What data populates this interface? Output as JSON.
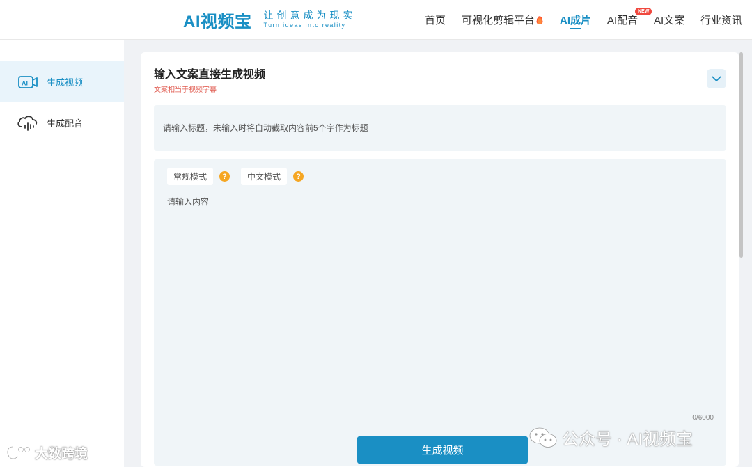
{
  "logo": {
    "main": "AI视频宝",
    "slogan_cn": "让创意成为现实",
    "slogan_en": "Turn ideas into reality"
  },
  "nav": {
    "items": [
      {
        "label": "首页"
      },
      {
        "label": "可视化剪辑平台"
      },
      {
        "label": "AI成片"
      },
      {
        "label": "AI配音"
      },
      {
        "label": "AI文案"
      },
      {
        "label": "行业资讯"
      }
    ],
    "new_badge": "NEW"
  },
  "sidebar": {
    "items": [
      {
        "label": "生成视频"
      },
      {
        "label": "生成配音"
      }
    ]
  },
  "card": {
    "title": "输入文案直接生成视频",
    "subtitle": "文案相当于视频字幕",
    "title_placeholder": "请输入标题，未输入时将自动截取内容前5个字作为标题",
    "mode_normal": "常规模式",
    "mode_chinese": "中文模式",
    "content_placeholder": "请输入内容",
    "counter": "0/6000"
  },
  "generate_button": "生成视频",
  "watermark": {
    "left": "大数跨境",
    "right": "公众号 · AI视频宝"
  }
}
